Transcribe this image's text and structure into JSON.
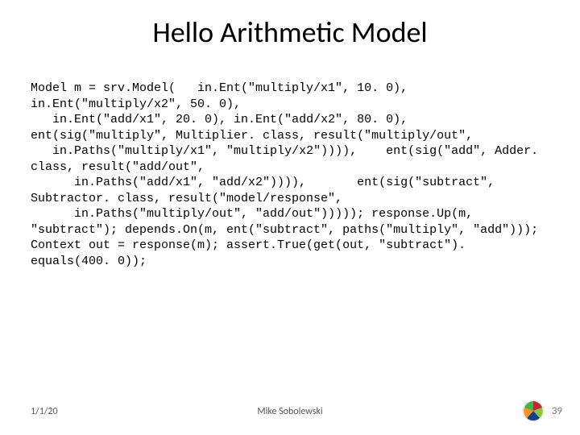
{
  "title": "Hello Arithmetic Model",
  "code": "Model m = srv.Model(   in.Ent(\"multiply/x1\", 10. 0), in.Ent(\"multiply/x2\", 50. 0),\n   in.Ent(\"add/x1\", 20. 0), in.Ent(\"add/x2\", 80. 0), ent(sig(\"multiply\", Multiplier. class, result(\"multiply/out\",\n   in.Paths(\"multiply/x1\", \"multiply/x2\")))),    ent(sig(\"add\", Adder. class, result(\"add/out\",\n      in.Paths(\"add/x1\", \"add/x2\")))),       ent(sig(\"subtract\", Subtractor. class, result(\"model/response\",\n      in.Paths(\"multiply/out\", \"add/out\"))))); response.Up(m, \"subtract\"); depends.On(m, ent(\"subtract\", paths(\"multiply\", \"add\"))); Context out = response(m); assert.True(get(out, \"subtract\"). equals(400. 0));",
  "footer": {
    "date": "1/1/20",
    "author": "Mike Sobolewski",
    "page": "39"
  }
}
